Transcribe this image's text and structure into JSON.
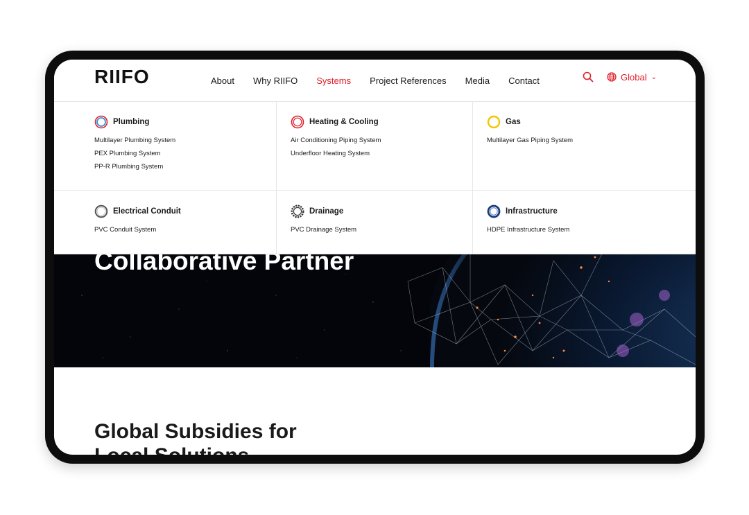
{
  "header": {
    "logo": "RIIFO",
    "nav": [
      {
        "label": "About",
        "active": false
      },
      {
        "label": "Why RIIFO",
        "active": false
      },
      {
        "label": "Systems",
        "active": true
      },
      {
        "label": "Project References",
        "active": false
      },
      {
        "label": "Media",
        "active": false
      },
      {
        "label": "Contact",
        "active": false
      }
    ],
    "language": "Global",
    "accent_color": "#e0202c"
  },
  "menu": {
    "categories": [
      {
        "title": "Plumbing",
        "icon": "plumbing-ring-icon",
        "color": "#3a8fd6",
        "links": [
          "Multilayer Plumbing System",
          "PEX Plumbing System",
          "PP-R Plumbing System"
        ]
      },
      {
        "title": "Heating & Cooling",
        "icon": "heating-ring-icon",
        "color": "#e0202c",
        "links": [
          "Air Conditioning Piping System",
          "Underfloor Heating System"
        ]
      },
      {
        "title": "Gas",
        "icon": "gas-ring-icon",
        "color": "#f5c400",
        "links": [
          "Multilayer Gas Piping System"
        ]
      },
      {
        "title": "Electrical Conduit",
        "icon": "conduit-ring-icon",
        "color": "#555555",
        "links": [
          "PVC Conduit System"
        ]
      },
      {
        "title": "Drainage",
        "icon": "drainage-ring-icon",
        "color": "#333333",
        "links": [
          "PVC Drainage System"
        ]
      },
      {
        "title": "Infrastructure",
        "icon": "infrastructure-ring-icon",
        "color": "#1a3a7a",
        "links": [
          "HDPE Infrastructure System"
        ]
      }
    ]
  },
  "hero": {
    "title": "Collaborative Partner"
  },
  "section": {
    "title_line1": "Global Subsidies for",
    "title_line2": "Local Solutions"
  }
}
